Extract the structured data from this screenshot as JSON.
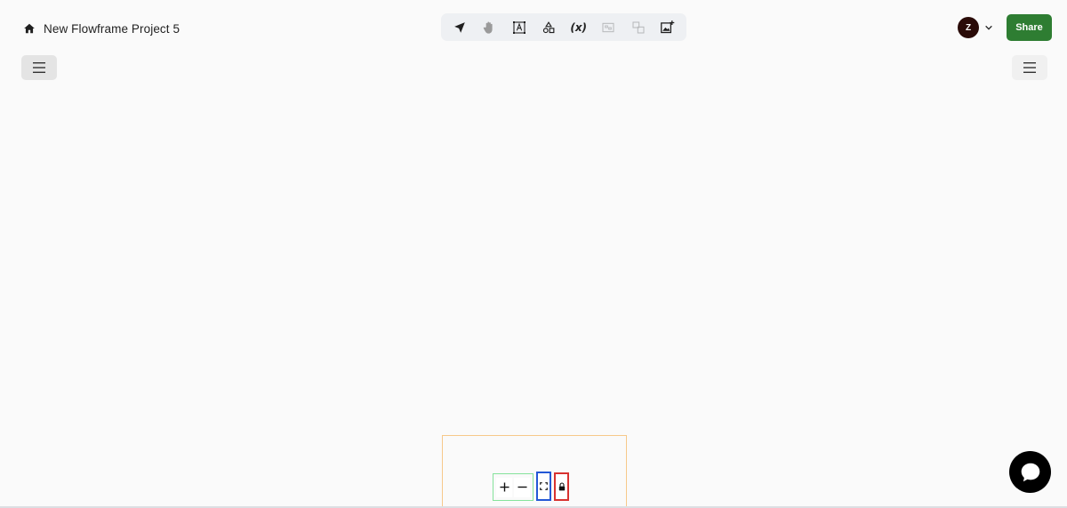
{
  "header": {
    "project_title": "New Flowframe Project 5",
    "home_icon": "home-icon"
  },
  "toolbar": {
    "tools": [
      {
        "name": "select",
        "icon": "cursor-arrow-icon",
        "enabled": true
      },
      {
        "name": "pan",
        "icon": "hand-icon",
        "enabled": true
      },
      {
        "name": "text",
        "icon": "text-frame-icon",
        "enabled": true
      },
      {
        "name": "shapes",
        "icon": "shapes-icon",
        "enabled": true
      },
      {
        "name": "variables",
        "icon": "variable-icon",
        "label": "(x)",
        "enabled": true
      },
      {
        "name": "group",
        "icon": "group-icon",
        "enabled": false
      },
      {
        "name": "ungroup",
        "icon": "ungroup-icon",
        "enabled": false
      },
      {
        "name": "add-image",
        "icon": "add-image-icon",
        "enabled": true
      }
    ]
  },
  "user": {
    "avatar_initial": "Z",
    "avatar_color": "#2a0b08"
  },
  "share": {
    "label": "Share",
    "color": "#2e7d32"
  },
  "canvas_controls": {
    "zoom_in_label": "+",
    "zoom_out_label": "−",
    "fit_icon": "fit-view-icon",
    "lock_icon": "lock-icon"
  },
  "chat": {
    "icon": "chat-bubble-icon"
  }
}
